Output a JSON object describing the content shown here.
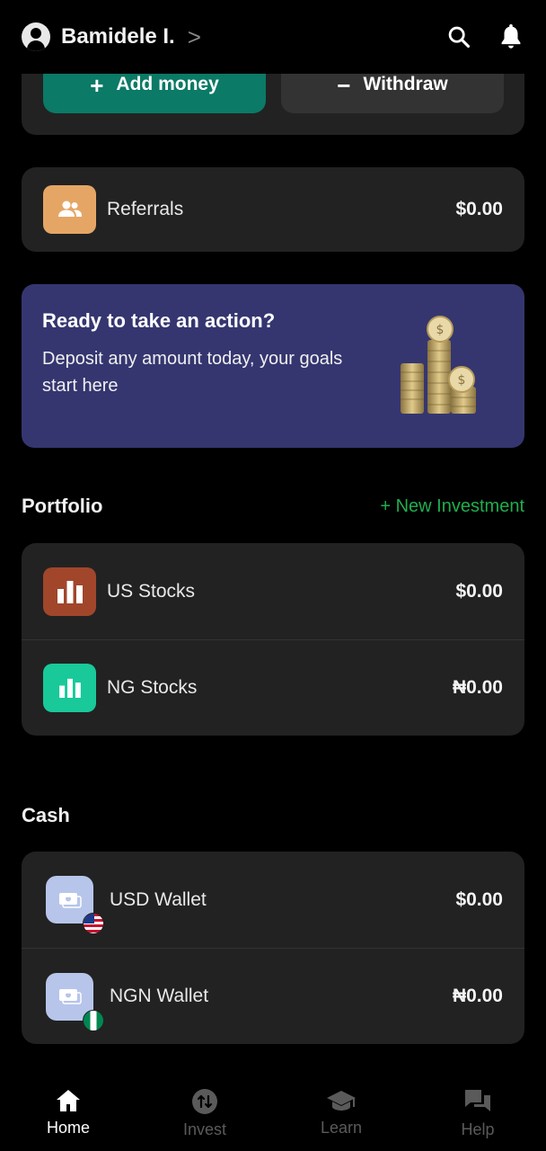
{
  "header": {
    "username": "Bamidele I.",
    "chevron": ">",
    "icons": [
      "profile-icon",
      "search-icon",
      "bell-icon"
    ]
  },
  "actions": {
    "add_money_label": "Add money",
    "add_glyph": "+",
    "withdraw_label": "Withdraw",
    "withdraw_glyph": "−"
  },
  "referrals": {
    "label": "Referrals",
    "value": "$0.00"
  },
  "promo": {
    "title": "Ready to take an action?",
    "text": "Deposit any amount today, your goals start here"
  },
  "portfolio": {
    "title": "Portfolio",
    "new_investment": "+ New Investment",
    "items": [
      {
        "label": "US Stocks",
        "value": "$0.00",
        "color": "#a1462b"
      },
      {
        "label": "NG Stocks",
        "value": "₦0.00",
        "color": "#19c99a"
      }
    ]
  },
  "cash": {
    "title": "Cash",
    "items": [
      {
        "label": "USD Wallet",
        "value": "$0.00"
      },
      {
        "label": "NGN Wallet",
        "value": "₦0.00"
      }
    ]
  },
  "nav": {
    "items": [
      {
        "label": "Home",
        "icon": "home-icon",
        "active": true
      },
      {
        "label": "Invest",
        "icon": "invest-icon"
      },
      {
        "label": "Learn",
        "icon": "graduation-cap-icon"
      },
      {
        "label": "Help",
        "icon": "chat-bubbles-icon"
      }
    ]
  },
  "colors": {
    "accent_green": "#0b7a66",
    "link_green": "#1fae4e",
    "promo_bg": "#353670",
    "card_bg": "#222222",
    "referral_tile": "#e5a665",
    "wallet_tile": "#b7c5ea"
  }
}
